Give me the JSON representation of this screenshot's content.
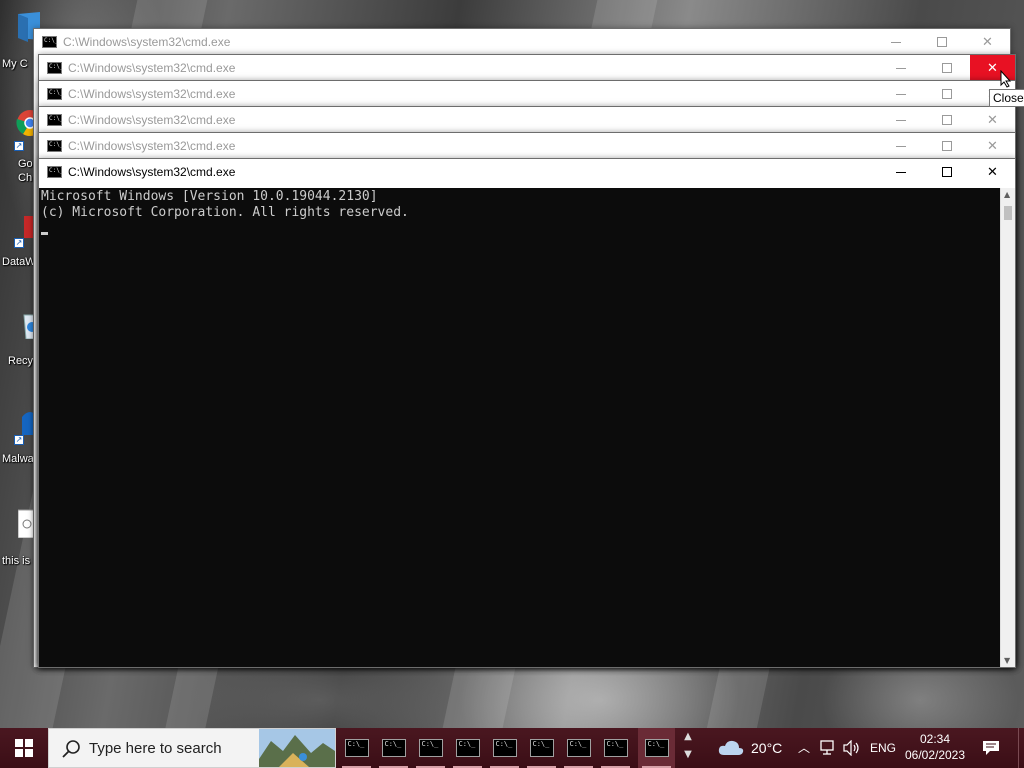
{
  "desktop": {
    "icons": [
      {
        "label": "My C"
      },
      {
        "label": "Go"
      },
      {
        "label": "Ch"
      },
      {
        "label": "DataW"
      },
      {
        "label": "Recy"
      },
      {
        "label": "Malwa"
      },
      {
        "label": "this is a"
      }
    ]
  },
  "windows": [
    {
      "title": "C:\\Windows\\system32\\cmd.exe"
    },
    {
      "title": "C:\\Windows\\system32\\cmd.exe"
    },
    {
      "title": "C:\\Windows\\system32\\cmd.exe"
    },
    {
      "title": "C:\\Windows\\system32\\cmd.exe"
    },
    {
      "title": "C:\\Windows\\system32\\cmd.exe"
    },
    {
      "title": "C:\\Windows\\system32\\cmd.exe"
    }
  ],
  "console": {
    "line1": "Microsoft Windows [Version 10.0.19044.2130]",
    "line2": "(c) Microsoft Corporation. All rights reserved."
  },
  "tooltip": "Close",
  "taskbar": {
    "search_placeholder": "Type here to search",
    "app_icon_text": "C:\\_",
    "weather": "20°C",
    "language": "ENG",
    "time": "02:34",
    "date": "06/02/2023"
  },
  "colors": {
    "close_hover": "#e81123",
    "console_bg": "#0c0c0c",
    "taskbar_bg": "#3b0e16"
  }
}
